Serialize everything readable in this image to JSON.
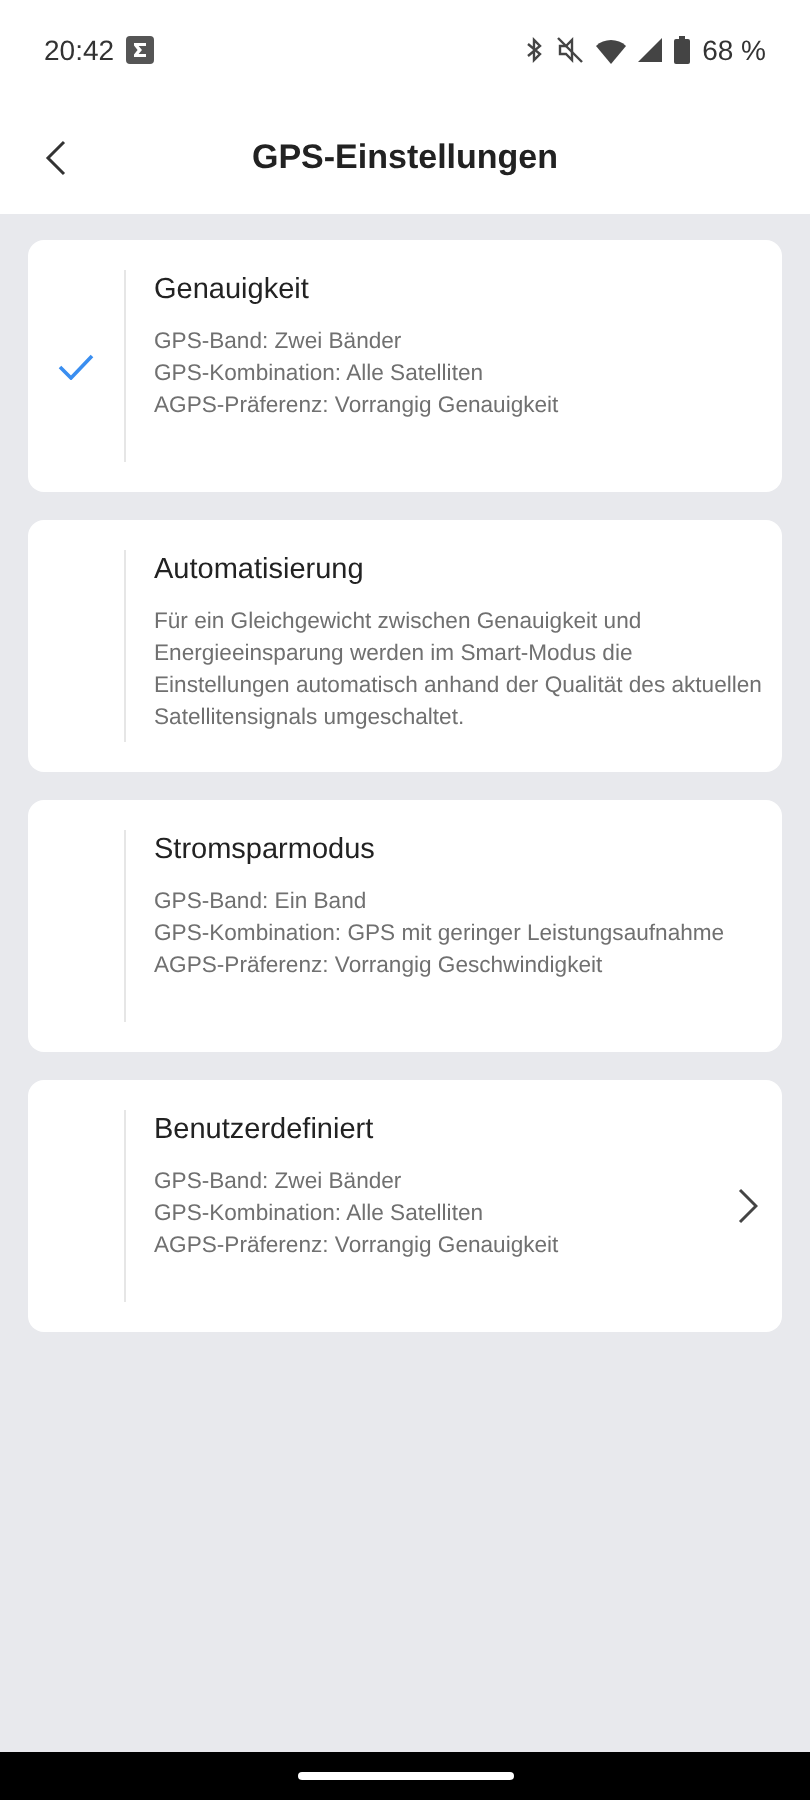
{
  "status_bar": {
    "time": "20:42",
    "battery": "68 %"
  },
  "header": {
    "title": "GPS-Einstellungen"
  },
  "options": [
    {
      "title": "Genauigkeit",
      "selected": true,
      "kind": "details",
      "chevron": false,
      "lines": [
        "GPS-Band: Zwei Bänder",
        "GPS-Kombination: Alle Satelliten",
        "AGPS-Präferenz: Vorrangig Genauigkeit"
      ]
    },
    {
      "title": "Automatisierung",
      "selected": false,
      "kind": "description",
      "chevron": false,
      "description": "Für ein Gleichgewicht zwischen Genauigkeit und Energieeinsparung werden im Smart-Modus die Einstellungen automatisch anhand der Qualität des aktuellen Satellitensignals umgeschaltet."
    },
    {
      "title": "Stromsparmodus",
      "selected": false,
      "kind": "details",
      "chevron": false,
      "lines": [
        "GPS-Band: Ein Band",
        "GPS-Kombination: GPS mit geringer Leistungsaufnahme",
        "AGPS-Präferenz: Vorrangig Geschwindigkeit"
      ]
    },
    {
      "title": "Benutzerdefiniert",
      "selected": false,
      "kind": "details",
      "chevron": true,
      "lines": [
        "GPS-Band: Zwei Bänder",
        "GPS-Kombination: Alle Satelliten",
        "AGPS-Präferenz: Vorrangig Genauigkeit"
      ]
    }
  ]
}
